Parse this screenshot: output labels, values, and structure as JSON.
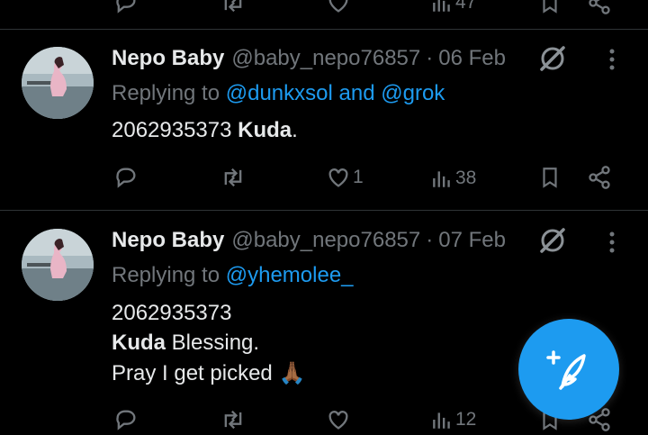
{
  "top_actions": {
    "views_count": "47"
  },
  "tweets": [
    {
      "name": "Nepo Baby",
      "handle": "@baby_nepo76857",
      "dot": "·",
      "date": "06 Feb",
      "replying_prefix": "Replying to",
      "mention_1": "@dunkxsol",
      "replying_and": "and",
      "mention_2": "@grok",
      "line1_text": "2062935373",
      "line1_bold": "Kuda",
      "line1_suffix": ".",
      "actions": {
        "likes": "1",
        "views": "38"
      }
    },
    {
      "name": "Nepo Baby",
      "handle": "@baby_nepo76857",
      "dot": "·",
      "date": "07 Feb",
      "replying_prefix": "Replying to",
      "mention_1": "@yhemolee_",
      "line1_text": "2062935373",
      "line2_bold": "Kuda",
      "line2_text": "Blessing.",
      "line3_text": "Pray I get picked",
      "line3_emoji": "🙏🏾",
      "actions": {
        "views": "12"
      }
    }
  ],
  "compose_fab": {
    "icon": "feather-plus-icon"
  },
  "colors": {
    "background": "#000000",
    "accent": "#1d9bf0",
    "muted": "#71767b",
    "text": "#e7e9ea"
  }
}
